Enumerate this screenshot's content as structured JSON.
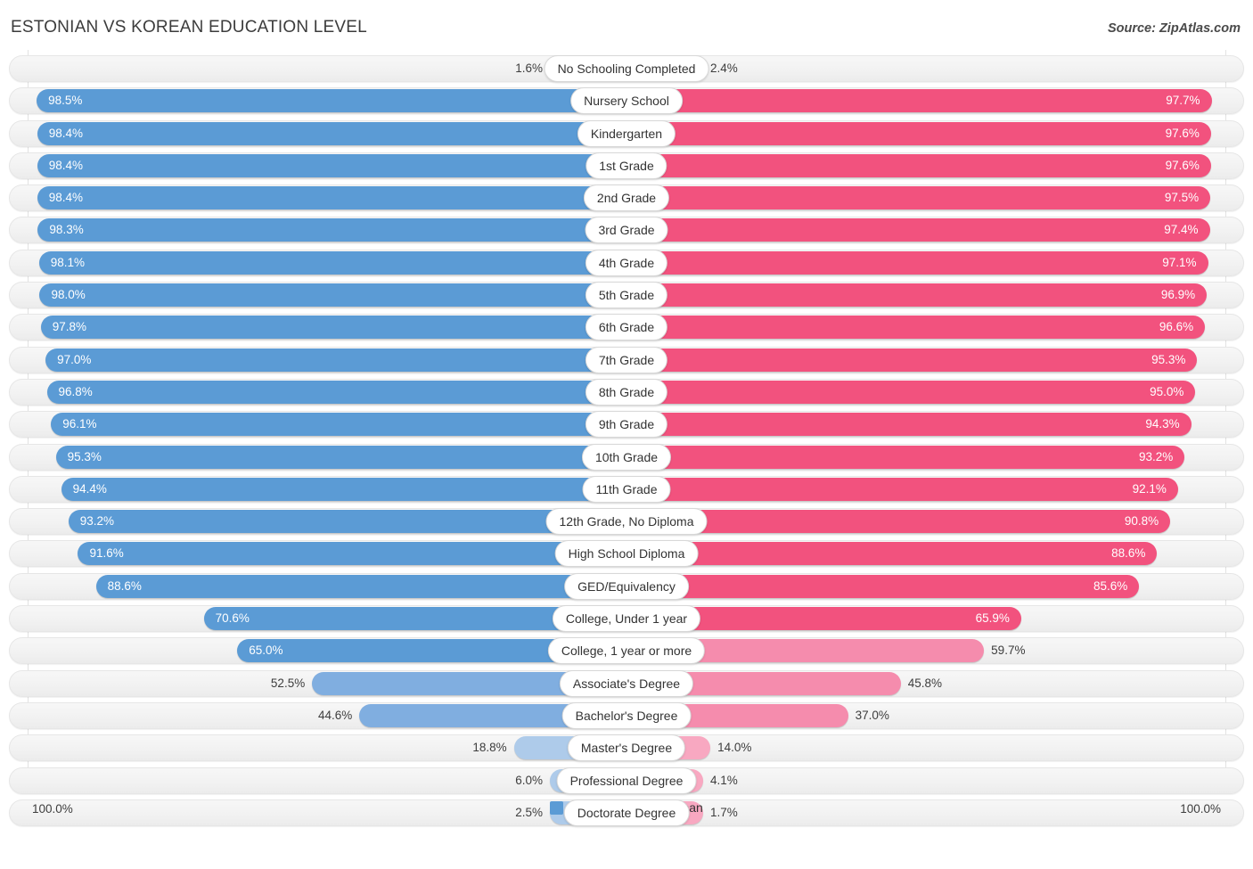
{
  "header": {
    "title": "ESTONIAN VS KOREAN EDUCATION LEVEL",
    "source": "Source: ZipAtlas.com"
  },
  "footer": {
    "axis_left": "100.0%",
    "axis_right": "100.0%",
    "legend": [
      {
        "label": "Estonian",
        "color": "#5B9BD5"
      },
      {
        "label": "Korean",
        "color": "#EE5586"
      }
    ]
  },
  "colors": {
    "estonian_strong": "#5B9BD5",
    "estonian_mid": "#80AEE0",
    "estonian_light": "#AECBEA",
    "korean_strong": "#F2527E",
    "korean_mid": "#F58CAD",
    "korean_light": "#F8A8C1",
    "track": "#F2F2F2",
    "gridline": "#E2E2E2"
  },
  "chart_data": {
    "type": "bar",
    "subtype": "diverging-bidirectional",
    "title": "ESTONIAN VS KOREAN EDUCATION LEVEL",
    "xlabel": "",
    "ylabel": "",
    "xlim": [
      0,
      100
    ],
    "axis_left_max": "100.0%",
    "axis_right_max": "100.0%",
    "grid": true,
    "legend_position": "bottom-center",
    "categories": [
      "No Schooling Completed",
      "Nursery School",
      "Kindergarten",
      "1st Grade",
      "2nd Grade",
      "3rd Grade",
      "4th Grade",
      "5th Grade",
      "6th Grade",
      "7th Grade",
      "8th Grade",
      "9th Grade",
      "10th Grade",
      "11th Grade",
      "12th Grade, No Diploma",
      "High School Diploma",
      "GED/Equivalency",
      "College, Under 1 year",
      "College, 1 year or more",
      "Associate's Degree",
      "Bachelor's Degree",
      "Master's Degree",
      "Professional Degree",
      "Doctorate Degree"
    ],
    "series": [
      {
        "name": "Estonian",
        "side": "left",
        "color": "#5B9BD5",
        "values": [
          1.6,
          98.5,
          98.4,
          98.4,
          98.4,
          98.3,
          98.1,
          98.0,
          97.8,
          97.0,
          96.8,
          96.1,
          95.3,
          94.4,
          93.2,
          91.6,
          88.6,
          70.6,
          65.0,
          52.5,
          44.6,
          18.8,
          6.0,
          2.5
        ],
        "labels": [
          "1.6%",
          "98.5%",
          "98.4%",
          "98.4%",
          "98.4%",
          "98.3%",
          "98.1%",
          "98.0%",
          "97.8%",
          "97.0%",
          "96.8%",
          "96.1%",
          "95.3%",
          "94.4%",
          "93.2%",
          "91.6%",
          "88.6%",
          "70.6%",
          "65.0%",
          "52.5%",
          "44.6%",
          "18.8%",
          "6.0%",
          "2.5%"
        ]
      },
      {
        "name": "Korean",
        "side": "right",
        "color": "#EE5586",
        "values": [
          2.4,
          97.7,
          97.6,
          97.6,
          97.5,
          97.4,
          97.1,
          96.9,
          96.6,
          95.3,
          95.0,
          94.3,
          93.2,
          92.1,
          90.8,
          88.6,
          85.6,
          65.9,
          59.7,
          45.8,
          37.0,
          14.0,
          4.1,
          1.7
        ],
        "labels": [
          "2.4%",
          "97.7%",
          "97.6%",
          "97.6%",
          "97.5%",
          "97.4%",
          "97.1%",
          "96.9%",
          "96.6%",
          "95.3%",
          "95.0%",
          "94.3%",
          "93.2%",
          "92.1%",
          "90.8%",
          "88.6%",
          "85.6%",
          "65.9%",
          "59.7%",
          "45.8%",
          "37.0%",
          "14.0%",
          "4.1%",
          "1.7%"
        ]
      }
    ]
  }
}
